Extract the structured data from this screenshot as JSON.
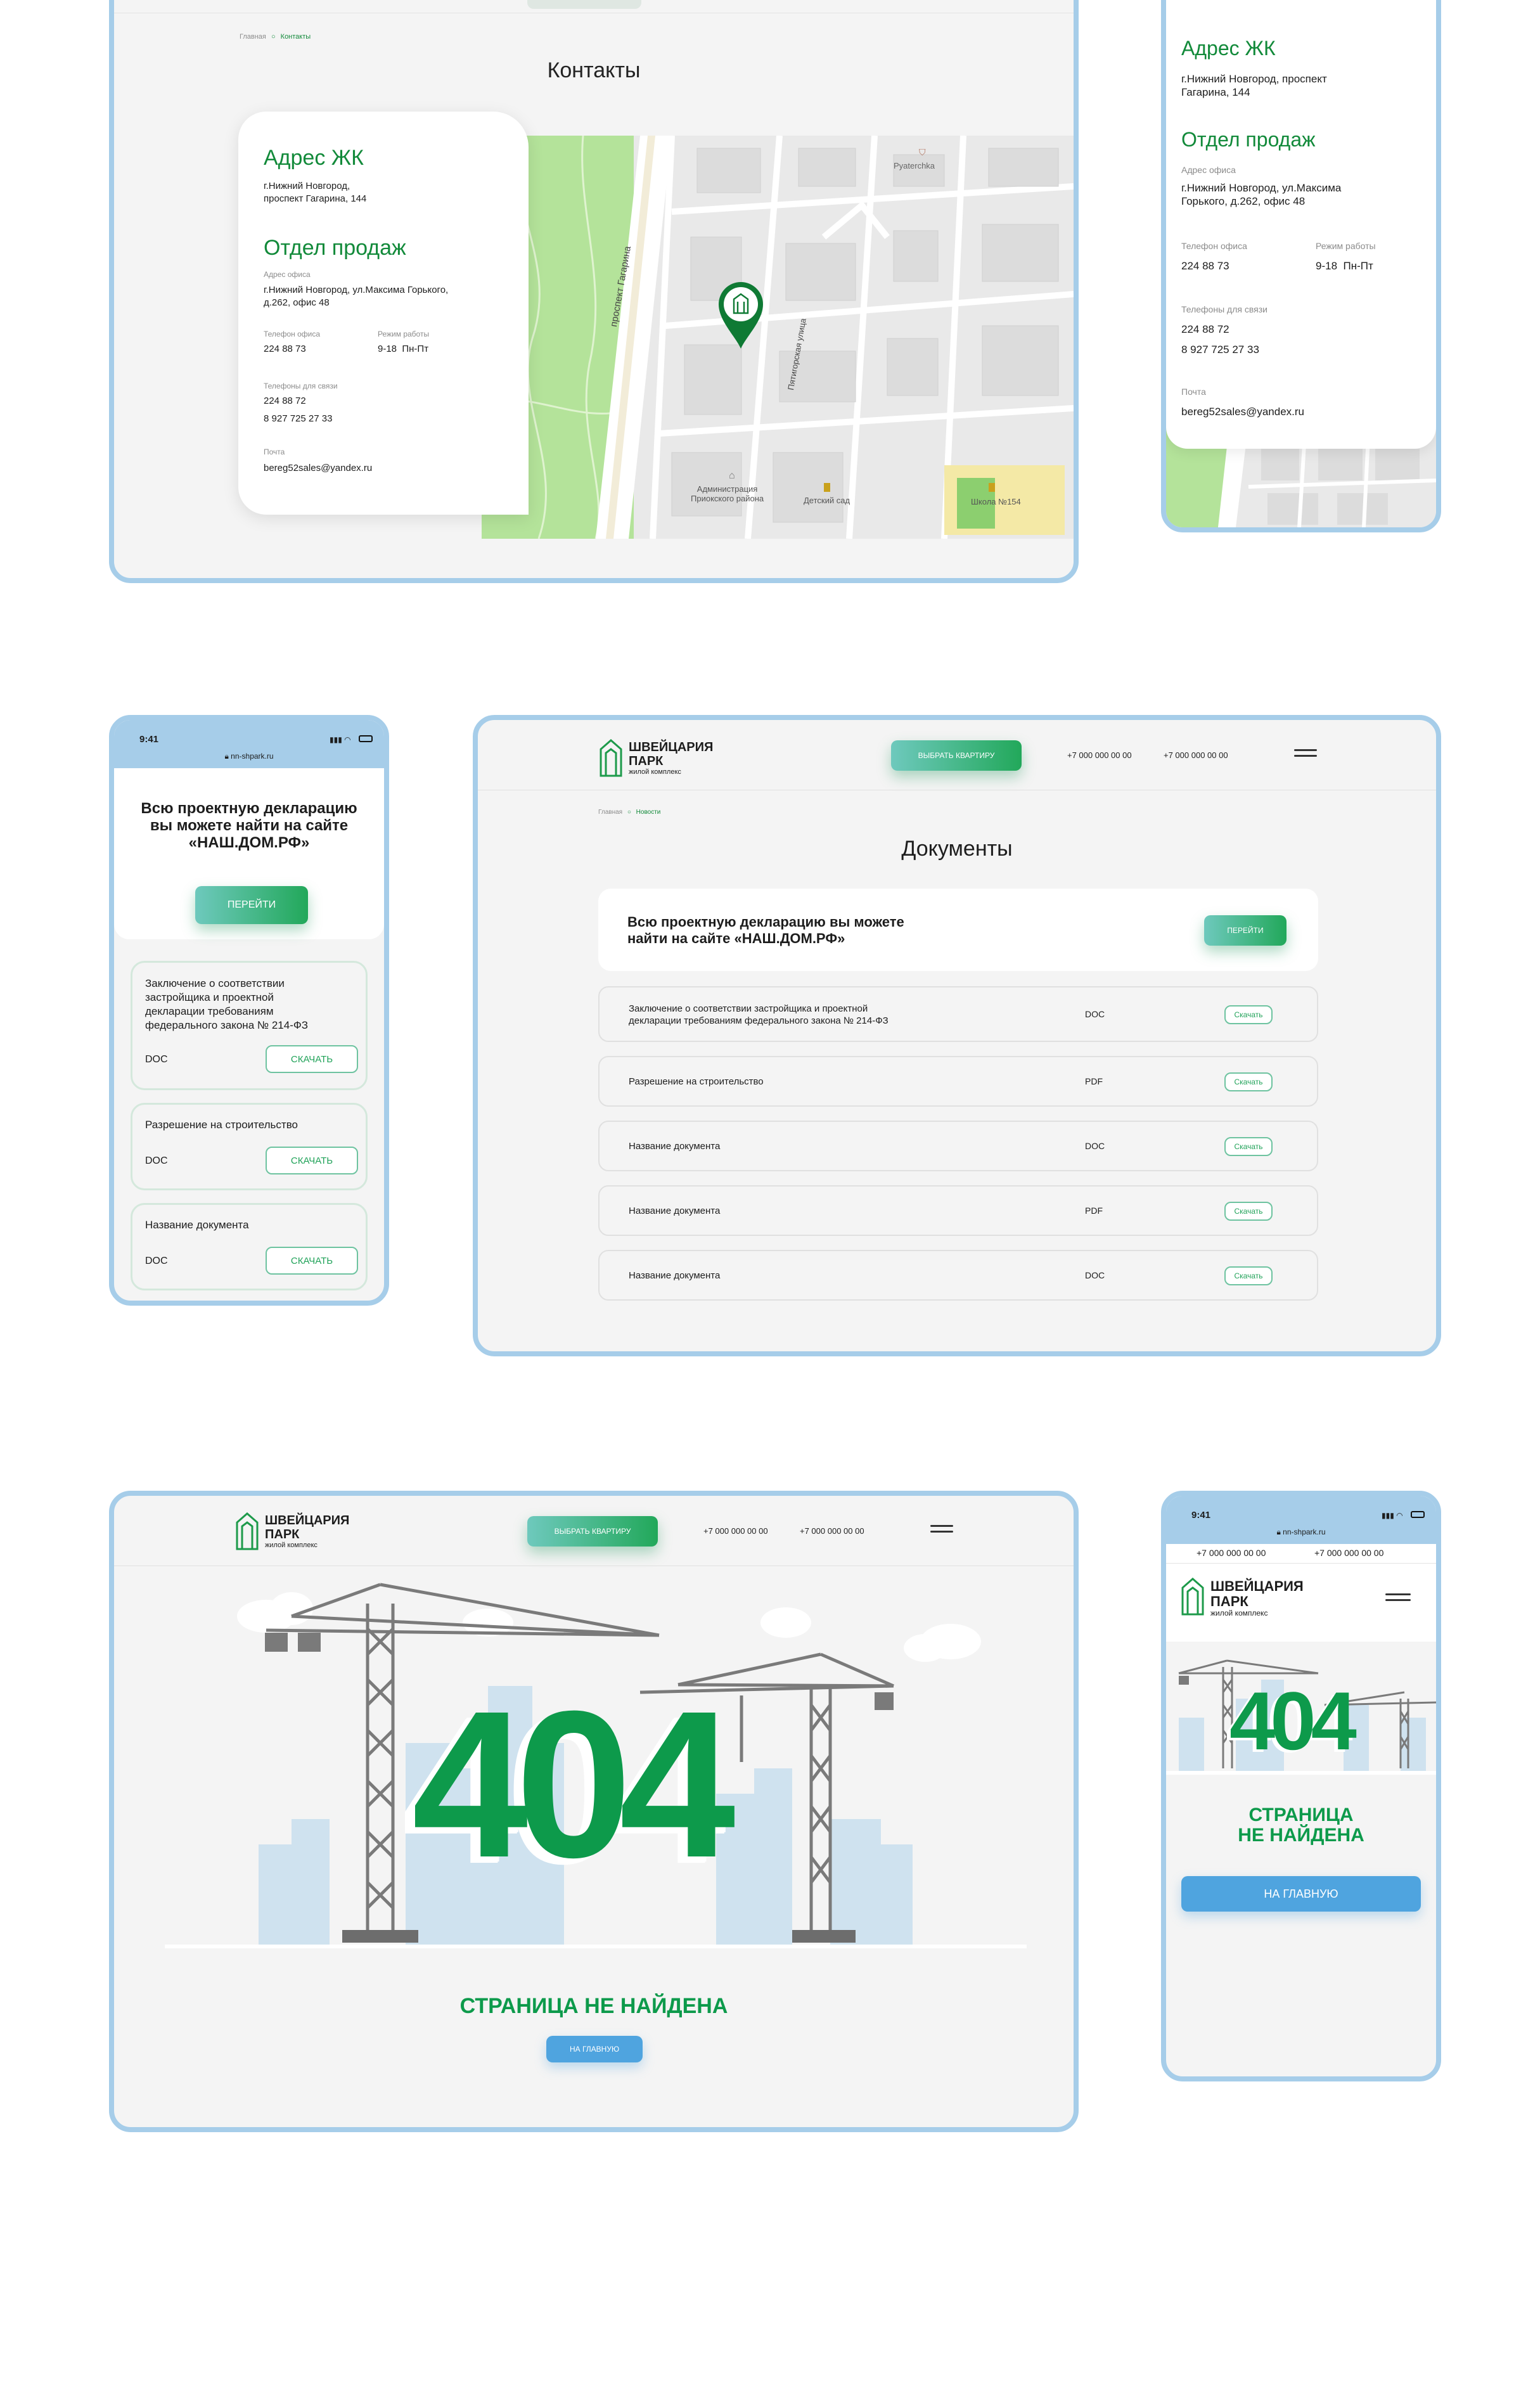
{
  "contacts_desktop": {
    "breadcrumb": {
      "home": "Главная",
      "current": "Контакты"
    },
    "title": "Контакты",
    "card": {
      "complex_heading": "Адрес ЖК",
      "complex_address": "г.Нижний Новгород,\nпроспект Гагарина, 144",
      "sales_heading": "Отдел продаж",
      "office_label": "Адрес офиса",
      "office_address": "г.Нижний Новгород, ул.Максима Горького,\nд.262, офис 48",
      "office_phone_label": "Телефон офиса",
      "office_phone": "224 88 73",
      "hours_label": "Режим работы",
      "hours": "9-18  Пн-Пт",
      "contact_phones_label": "Телефоны для связи",
      "contact_phone_1": "224 88 72",
      "contact_phone_2": "8 927 725 27 33",
      "mail_label": "Почта",
      "mail": "bereg52sales@yandex.ru"
    },
    "map": {
      "street_1": "проспект Гагарина",
      "street_2": "Пятигорская улица",
      "poi_1": "Pyaterchka",
      "poi_2": "Администрация\nПриокского района",
      "poi_3": "Детский сад",
      "poi_4": "Школа №154"
    }
  },
  "contacts_mobile": {
    "complex_heading": "Адрес ЖК",
    "complex_address": "г.Нижний Новгород, проспект\nГагарина, 144",
    "sales_heading": "Отдел продаж",
    "office_label": "Адрес офиса",
    "office_address": "г.Нижний Новгород, ул.Максима\nГорького, д.262, офис 48",
    "office_phone_label": "Телефон офиса",
    "office_phone": "224 88 73",
    "hours_label": "Режим работы",
    "hours": "9-18  Пн-Пт",
    "contact_phones_label": "Телефоны для связи",
    "contact_phone_1": "224 88 72",
    "contact_phone_2": "8 927 725 27 33",
    "mail_label": "Почта",
    "mail": "bereg52sales@yandex.ru"
  },
  "docs_mobile": {
    "status_time": "9:41",
    "url": "nn-shpark.ru",
    "banner_text": "Всю проектную декларацию вы можете найти на сайте «НАШ.ДОМ.РФ»",
    "go_button": "ПЕРЕЙТИ",
    "items": [
      {
        "name": "Заключение о соответствии застройщика и проектной декларации требованиям федерального закона № 214-ФЗ",
        "type": "DOC",
        "action": "СКАЧАТЬ"
      },
      {
        "name": "Разрешение на строительство",
        "type": "DOC",
        "action": "СКАЧАТЬ"
      },
      {
        "name": "Название документа",
        "type": "DOC",
        "action": "СКАЧАТЬ"
      }
    ]
  },
  "docs_desktop": {
    "logo_line1": "ШВЕЙЦАРИЯ",
    "logo_line2": "ПАРК",
    "logo_sub": "жилой комплекс",
    "choose_button": "ВЫБРАТЬ КВАРТИРУ",
    "phone_1": "+7 000 000 00 00",
    "phone_2": "+7 000 000 00 00",
    "breadcrumb": {
      "home": "Главная",
      "current": "Новости"
    },
    "title": "Документы",
    "banner_text": "Всю проектную декларацию вы можете\nнайти на сайте «НАШ.ДОМ.РФ»",
    "go_button": "ПЕРЕЙТИ",
    "rows": [
      {
        "name": "Заключение о соответствии застройщика и проектной\nдекларации требованиям федерального закона № 214-ФЗ",
        "type": "DOC",
        "action": "Скачать"
      },
      {
        "name": "Разрешение на строительство",
        "type": "PDF",
        "action": "Скачать"
      },
      {
        "name": "Название документа",
        "type": "DOC",
        "action": "Скачать"
      },
      {
        "name": "Название документа",
        "type": "PDF",
        "action": "Скачать"
      },
      {
        "name": "Название документа",
        "type": "DOC",
        "action": "Скачать"
      }
    ]
  },
  "notfound_desktop": {
    "logo_line1": "ШВЕЙЦАРИЯ",
    "logo_line2": "ПАРК",
    "logo_sub": "жилой комплекс",
    "choose_button": "ВЫБРАТЬ КВАРТИРУ",
    "phone_1": "+7 000 000 00 00",
    "phone_2": "+7 000 000 00 00",
    "code": "404",
    "message": "СТРАНИЦА НЕ НАЙДЕНА",
    "home_button": "НА ГЛАВНУЮ"
  },
  "notfound_mobile": {
    "status_time": "9:41",
    "url": "nn-shpark.ru",
    "phone_1": "+7 000 000 00 00",
    "phone_2": "+7 000 000 00 00",
    "logo_line1": "ШВЕЙЦАРИЯ",
    "logo_line2": "ПАРК",
    "logo_sub": "жилой комплекс",
    "code": "404",
    "message": "СТРАНИЦА\nНЕ НАЙДЕНА",
    "home_button": "НА ГЛАВНУЮ"
  },
  "colors": {
    "brand_green": "#128a3a",
    "frame_blue": "#a6cde9",
    "button_blue": "#4fa4df",
    "map_green": "#b4e39a"
  }
}
